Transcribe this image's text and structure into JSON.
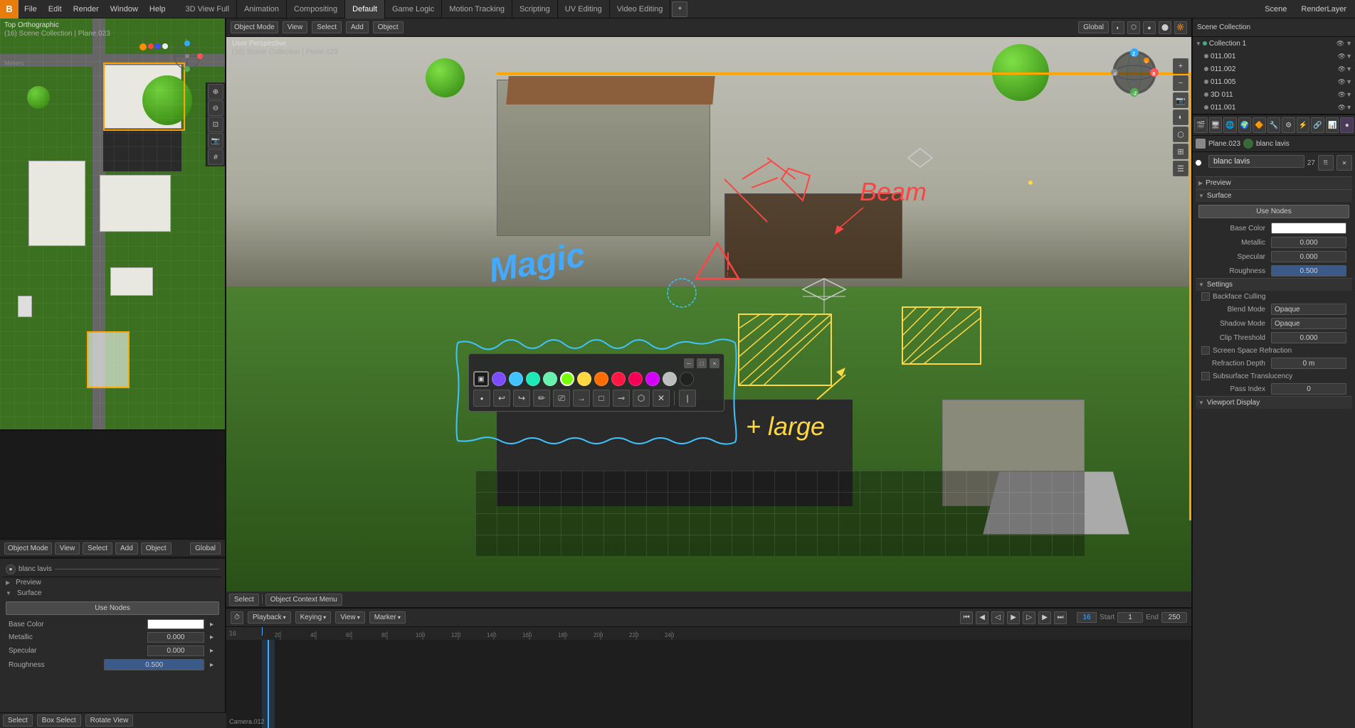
{
  "app": {
    "title": "Blender",
    "logo": "B"
  },
  "top_menu": {
    "items": [
      "File",
      "Edit",
      "Render",
      "Window",
      "Help"
    ]
  },
  "workspace_tabs": [
    {
      "label": "3D View Full",
      "active": false
    },
    {
      "label": "Animation",
      "active": false
    },
    {
      "label": "Compositing",
      "active": false
    },
    {
      "label": "Default",
      "active": true
    },
    {
      "label": "Game Logic",
      "active": false
    },
    {
      "label": "Motion Tracking",
      "active": false
    },
    {
      "label": "Scripting",
      "active": false
    },
    {
      "label": "UV Editing",
      "active": false
    },
    {
      "label": "Video Editing",
      "active": false
    }
  ],
  "scene": {
    "name": "Scene"
  },
  "render_layer": {
    "name": "RenderLayer"
  },
  "top_ortho": {
    "label": "Top Orthographic",
    "sub_label": "(16) Scene Collection | Plane.023",
    "meters": "Meters"
  },
  "main_viewport": {
    "label": "User Perspective",
    "sub_label": "(16) Scene Collection | Plane.023"
  },
  "toolbar": {
    "view_label": "View",
    "select_label": "Select",
    "add_label": "Add",
    "object_label": "Object"
  },
  "grease_pencil": {
    "colors": [
      {
        "name": "purple",
        "hex": "#7c4dff"
      },
      {
        "name": "blue",
        "hex": "#40c4ff"
      },
      {
        "name": "teal",
        "hex": "#1de9b6"
      },
      {
        "name": "green",
        "hex": "#69f0ae"
      },
      {
        "name": "green-check",
        "hex": "#76ff03"
      },
      {
        "name": "yellow",
        "hex": "#ffd740"
      },
      {
        "name": "orange",
        "hex": "#ff6d00"
      },
      {
        "name": "red",
        "hex": "#ff1744"
      },
      {
        "name": "pink",
        "hex": "#f50057"
      },
      {
        "name": "magenta",
        "hex": "#d500f9"
      },
      {
        "name": "light-gray",
        "hex": "#bdbdbd"
      },
      {
        "name": "dark",
        "hex": "#212121"
      }
    ],
    "tools": [
      "undo",
      "redo",
      "annotate",
      "erase",
      "line",
      "box",
      "lasso",
      "eyedropper",
      "clear",
      "separator"
    ]
  },
  "mode_dropdown": {
    "label": "Object Mode"
  },
  "global_label": "Global",
  "timeline": {
    "playback_label": "Playback",
    "keying_label": "Keying",
    "view_label": "View",
    "marker_label": "Marker",
    "start": 1,
    "end": 250,
    "current_frame": 16,
    "ruler_marks": [
      20,
      40,
      60,
      80,
      100,
      120,
      140,
      160,
      180,
      200,
      220,
      240
    ]
  },
  "scene_collection": {
    "header": "Scene Collection",
    "collection_label": "Collection 1",
    "items": [
      {
        "name": "011.001",
        "type": "mesh"
      },
      {
        "name": "011.002",
        "type": "mesh"
      },
      {
        "name": "011.005",
        "type": "mesh"
      },
      {
        "name": "3D 011",
        "type": "mesh"
      },
      {
        "name": "011.001",
        "type": "mesh"
      }
    ]
  },
  "properties_panel": {
    "object_name": "Plane.023",
    "material_name": "blanc lavis",
    "material_slot": "blanc lavis",
    "material_slot_num": "27",
    "sections": {
      "preview": "Preview",
      "surface": "Surface"
    },
    "use_nodes_label": "Use Nodes",
    "fields": {
      "base_color_label": "Base Color",
      "metallic_label": "Metallic",
      "metallic_value": "0.000",
      "specular_label": "Specular",
      "specular_value": "0.000",
      "roughness_label": "Roughness",
      "roughness_value": "0.500",
      "settings_label": "Settings",
      "backface_culling": "Backface Culling",
      "blend_mode_label": "Blend Mode",
      "blend_mode_value": "Opaque",
      "shadow_mode_label": "Shadow Mode",
      "shadow_mode_value": "Opaque",
      "clip_threshold_label": "Clip Threshold",
      "clip_threshold_value": "0.000",
      "screen_space_refraction": "Screen Space Refraction",
      "refraction_depth_label": "Refraction Depth",
      "refraction_depth_value": "0 m",
      "subsurface_translucency": "Subsurface Translucency",
      "pass_index_label": "Pass Index",
      "pass_index_value": "0",
      "viewport_display_label": "Viewport Display"
    }
  },
  "left_panel": {
    "material_name": "blanc lavis",
    "use_nodes_label": "Use Nodes",
    "surface_label": "Surface",
    "base_color_label": "Base Color",
    "metallic_label": "Metallic",
    "metallic_value": "0.000",
    "specular_label": "Specular",
    "specular_value": "0.000",
    "roughness_label": "Roughness",
    "roughness_value": "0.500"
  },
  "bottom_status": {
    "select_label": "Select",
    "box_select_label": "Box Select",
    "rotate_view_label": "Rotate View",
    "object_context_label": "Object Context Menu"
  },
  "center_bottom_bar": {
    "select_label": "Select",
    "object_context_label": "Object Context Menu"
  },
  "viewport_header_left": {
    "view_label": "View",
    "select_label": "Select",
    "add_label": "Add",
    "object_label": "Object"
  }
}
